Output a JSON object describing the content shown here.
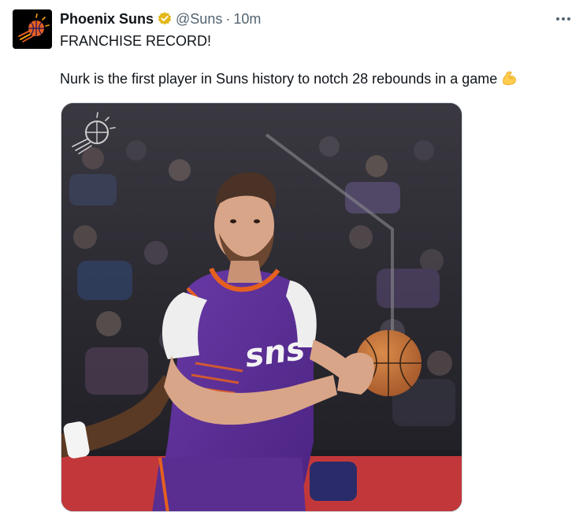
{
  "author": {
    "display_name": "Phoenix Suns",
    "handle": "@Suns",
    "separator": "·",
    "time": "10m",
    "avatar_icon": "suns-logo-icon",
    "verified_icon": "gold-verified-badge-icon"
  },
  "tweet": {
    "headline": "FRANCHISE RECORD!",
    "body": "Nurk is the first player in Suns history to notch 28 rebounds in a game",
    "emoji": "flexed-biceps-emoji"
  },
  "media": {
    "type": "photo",
    "icon": "suns-watermark-icon"
  },
  "menu": {
    "icon": "more-options-icon"
  },
  "colors": {
    "text_primary": "#0f1419",
    "text_secondary": "#536471",
    "verified_gold": "#e2b719",
    "suns_purple": "#5a2d91",
    "suns_orange": "#e56020"
  }
}
